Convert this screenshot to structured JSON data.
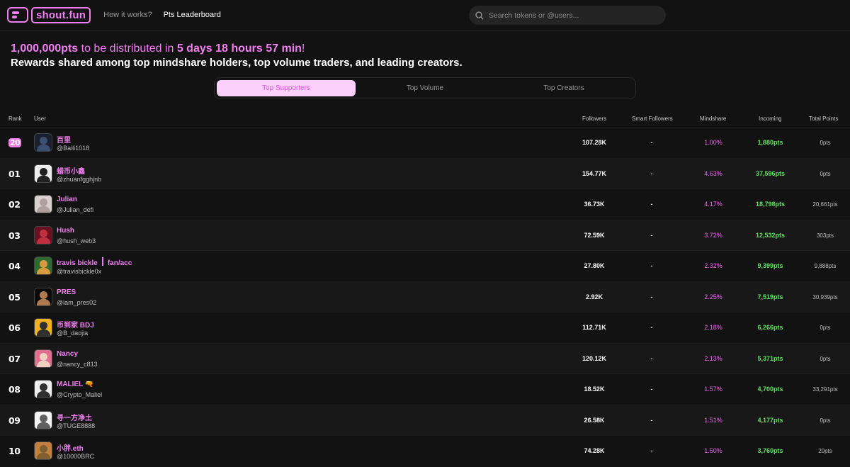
{
  "header": {
    "logo_text": "shout.fun",
    "nav": [
      {
        "label": "How it works?"
      },
      {
        "label": "Pts Leaderboard"
      }
    ],
    "search_placeholder": "Search tokens or @users..."
  },
  "banner": {
    "points": "1,000,000pts",
    "mid_text": " to be distributed in ",
    "countdown": "5 days 18 hours 57 min",
    "bang": "!",
    "subtitle": "Rewards shared among top mindshare holders, top volume traders, and leading creators."
  },
  "tabs": [
    {
      "label": "Top Supporters",
      "active": true
    },
    {
      "label": "Top Volume",
      "active": false
    },
    {
      "label": "Top Creators",
      "active": false
    }
  ],
  "columns": {
    "rank": "Rank",
    "user": "User",
    "followers": "Followers",
    "smart_followers": "Smart Followers",
    "mindshare": "Mindshare",
    "incoming": "Incoming",
    "total_points": "Total Points"
  },
  "rows": [
    {
      "rank": "20",
      "name": "百里",
      "handle": "@Baili1018",
      "followers": "107.28K",
      "smart": "-",
      "mindshare": "1.00%",
      "incoming": "1,880pts",
      "total": "0pts",
      "avatar": [
        "#1a2030",
        "#3a5070"
      ]
    },
    {
      "rank": "01",
      "name": "蜡币小鑫",
      "handle": "@zhuanfgghjnb",
      "followers": "154.77K",
      "smart": "-",
      "mindshare": "4.63%",
      "incoming": "37,596pts",
      "total": "0pts",
      "avatar": [
        "#eeeeee",
        "#222222"
      ]
    },
    {
      "rank": "02",
      "name": "Julian",
      "handle": "@Julian_defi",
      "followers": "36.73K",
      "smart": "-",
      "mindshare": "4.17%",
      "incoming": "18,798pts",
      "total": "20,661pts",
      "avatar": [
        "#d9d0d0",
        "#b0a0a0"
      ]
    },
    {
      "rank": "03",
      "name": "Hush",
      "handle": "@hush_web3",
      "followers": "72.59K",
      "smart": "-",
      "mindshare": "3.72%",
      "incoming": "12,532pts",
      "total": "303pts",
      "avatar": [
        "#6a1020",
        "#c03040"
      ]
    },
    {
      "rank": "04",
      "name": "travis bickle",
      "name_suffix": "fan/acc",
      "handle": "@travisbickle0x",
      "followers": "27.80K",
      "smart": "-",
      "mindshare": "2.32%",
      "incoming": "9,399pts",
      "total": "9,888pts",
      "avatar": [
        "#2f6a2f",
        "#d89a40"
      ]
    },
    {
      "rank": "05",
      "name": "PRES",
      "handle": "@iam_pres02",
      "followers": "2.92K",
      "smart": "-",
      "mindshare": "2.25%",
      "incoming": "7,519pts",
      "total": "30,939pts",
      "avatar": [
        "#0a0a0a",
        "#b07a50"
      ]
    },
    {
      "rank": "06",
      "name": "币到家 BDJ",
      "handle": "@B_daojia",
      "followers": "112.71K",
      "smart": "-",
      "mindshare": "2.18%",
      "incoming": "6,266pts",
      "total": "0pts",
      "avatar": [
        "#f0b020",
        "#303030"
      ]
    },
    {
      "rank": "07",
      "name": "Nancy",
      "handle": "@nancy_c813",
      "followers": "120.12K",
      "smart": "-",
      "mindshare": "2.13%",
      "incoming": "5,371pts",
      "total": "0pts",
      "avatar": [
        "#e07090",
        "#f0d0c0"
      ]
    },
    {
      "rank": "08",
      "name": "MALIEL 🔫",
      "handle": "@Crypto_Maliel",
      "followers": "18.52K",
      "smart": "-",
      "mindshare": "1.57%",
      "incoming": "4,700pts",
      "total": "33,291pts",
      "avatar": [
        "#f0f0f0",
        "#303030"
      ]
    },
    {
      "rank": "09",
      "name": "寻一方净土",
      "handle": "@TUGE8888",
      "followers": "26.58K",
      "smart": "-",
      "mindshare": "1.51%",
      "incoming": "4,177pts",
      "total": "0pts",
      "avatar": [
        "#f5f5f5",
        "#606060"
      ]
    },
    {
      "rank": "10",
      "name": "小胖.eth",
      "handle": "@10000BRC",
      "followers": "74.28K",
      "smart": "-",
      "mindshare": "1.50%",
      "incoming": "3,760pts",
      "total": "20pts",
      "avatar": [
        "#c08040",
        "#806030"
      ]
    }
  ]
}
